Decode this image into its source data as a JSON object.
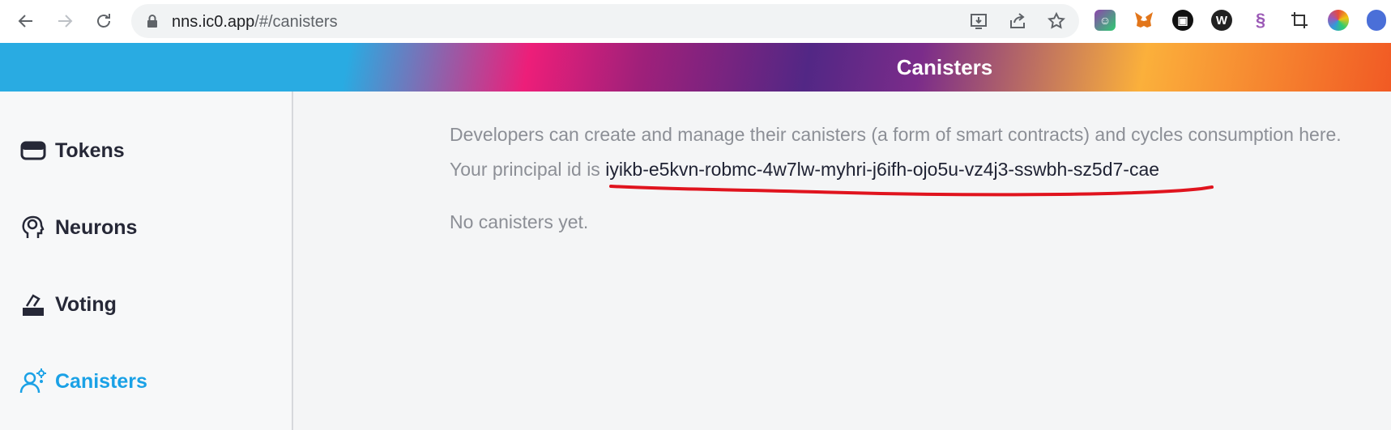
{
  "browser": {
    "url_host": "nns.ic0.app",
    "url_path": "/#/canisters",
    "icons": [
      "back-arrow-icon",
      "forward-arrow-icon",
      "reload-icon",
      "lock-icon",
      "install-icon",
      "share-icon",
      "star-icon"
    ],
    "extensions": [
      "extension-1",
      "metamask-fox-icon",
      "extension-3",
      "extension-w",
      "extension-s",
      "extension-crop",
      "extension-color",
      "extension-globe"
    ]
  },
  "header": {
    "title": "Canisters"
  },
  "sidebar": {
    "items": [
      {
        "label": "Tokens",
        "icon": "wallet-icon",
        "active": false
      },
      {
        "label": "Neurons",
        "icon": "brain-head-icon",
        "active": false
      },
      {
        "label": "Voting",
        "icon": "ballot-box-icon",
        "active": false
      },
      {
        "label": "Canisters",
        "icon": "canister-user-gear-icon",
        "active": true
      }
    ]
  },
  "main": {
    "description": "Developers can create and manage their canisters (a form of smart contracts) and cycles consumption here.",
    "principal_prefix": "Your principal id is",
    "principal_id": "iyikb-e5kvn-robmc-4w7lw-myhri-j6ifh-ojo5u-vz4j3-sswbh-sz5d7-cae",
    "empty_message": "No canisters yet."
  },
  "colors": {
    "active": "#1aa1e6",
    "text_dark": "#262837",
    "text_muted": "#8c8f96",
    "annotation_red": "#e0141e"
  }
}
